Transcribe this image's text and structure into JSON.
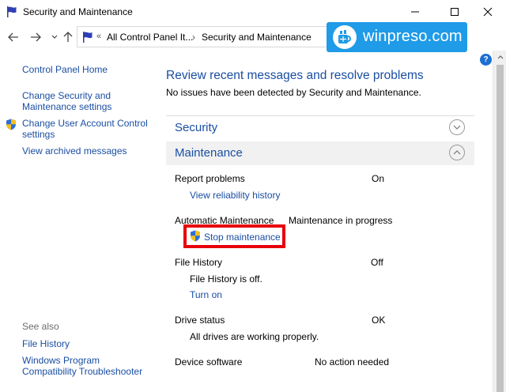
{
  "window": {
    "title": "Security and Maintenance"
  },
  "address": {
    "overflow": "«",
    "part1": "All Control Panel It...",
    "separator": "›",
    "part2": "Security and Maintenance"
  },
  "watermark": {
    "text": "winpreso.com"
  },
  "help": {
    "label": "?"
  },
  "sidebar": {
    "home": "Control Panel Home",
    "change_security_line1": "Change Security and",
    "change_security_line2": "Maintenance settings",
    "uac_line1": "Change User Account Control",
    "uac_line2": "settings",
    "archived": "View archived messages",
    "see_also": "See also",
    "file_history": "File History",
    "compat_line1": "Windows Program",
    "compat_line2": "Compatibility Troubleshooter"
  },
  "main": {
    "heading": "Review recent messages and resolve problems",
    "subheading": "No issues have been detected by Security and Maintenance.",
    "security_title": "Security",
    "maintenance_title": "Maintenance",
    "rows": {
      "report_problems": {
        "label": "Report problems",
        "value": "On",
        "link": "View reliability history"
      },
      "auto_maintenance": {
        "label": "Automatic Maintenance",
        "value": "Maintenance in progress",
        "link": "Stop maintenance"
      },
      "file_history": {
        "label": "File History",
        "value": "Off",
        "info": "File History is off.",
        "link": "Turn on"
      },
      "drive_status": {
        "label": "Drive status",
        "value": "OK",
        "info": "All drives are working properly."
      },
      "device_software": {
        "label": "Device software",
        "value": "No action needed"
      }
    }
  },
  "colors": {
    "link": "#1a4ea2",
    "highlight": "#e8000a",
    "watermark_bg": "#1f9be8"
  }
}
